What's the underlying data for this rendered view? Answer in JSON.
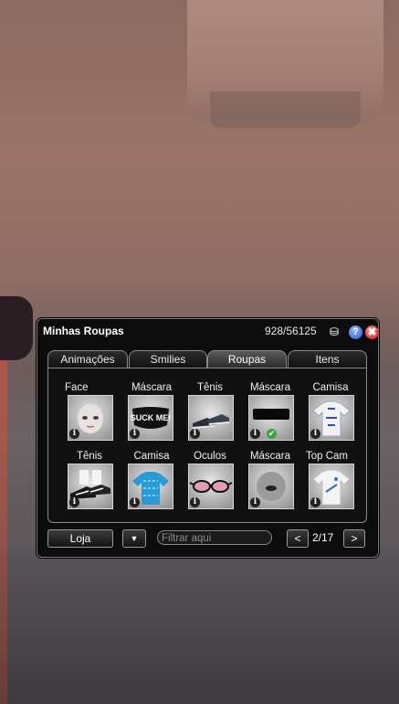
{
  "window": {
    "title": "Minhas Roupas",
    "counter": "928/56125",
    "help_glyph": "?",
    "close_glyph": "✖"
  },
  "tabs": [
    "Animações",
    "Smilies",
    "Roupas",
    "Itens"
  ],
  "active_tab": "Roupas",
  "items": [
    {
      "label": "Face",
      "icon": "face-icon",
      "equipped": false
    },
    {
      "label": "Máscara",
      "icon": "mask-suck-me-icon",
      "equipped": false
    },
    {
      "label": "Tênis",
      "icon": "sneakers-icon",
      "equipped": false
    },
    {
      "label": "Máscara",
      "icon": "black-mask-icon",
      "equipped": true
    },
    {
      "label": "Camisa",
      "icon": "white-shirt-icon",
      "equipped": false
    },
    {
      "label": "Tênis",
      "icon": "nike-sneakers-icon",
      "equipped": false
    },
    {
      "label": "Camisa",
      "icon": "blue-shirt-icon",
      "equipped": false
    },
    {
      "label": "Óculos",
      "icon": "pink-glasses-icon",
      "equipped": false
    },
    {
      "label": "Máscara",
      "icon": "grey-mask-icon",
      "equipped": false
    },
    {
      "label": "Top Cam",
      "icon": "white-top-shirt-icon",
      "equipped": false
    }
  ],
  "bottom": {
    "shop_label": "Loja",
    "dropdown_glyph": "▼",
    "filter_placeholder": "Filtrar aqui",
    "prev_glyph": "<",
    "page": "2/17",
    "next_glyph": ">"
  },
  "colors": {
    "accent_check": "#3aa63a",
    "help": "#2556c8",
    "close": "#c81818"
  }
}
